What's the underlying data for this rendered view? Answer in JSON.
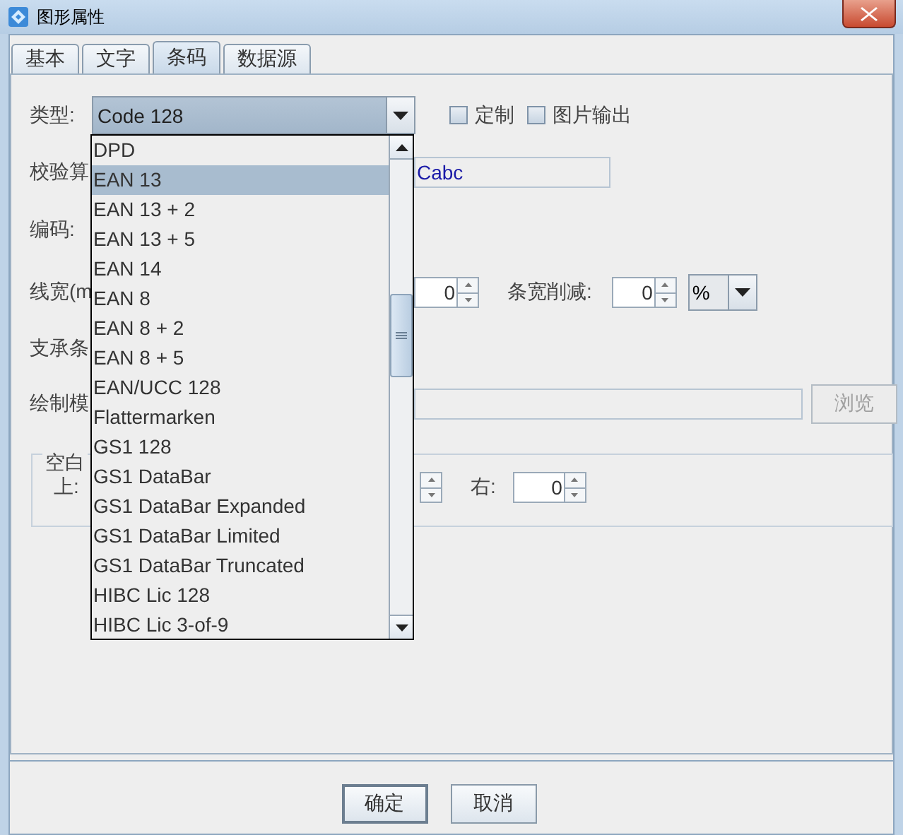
{
  "window": {
    "title": "图形属性"
  },
  "tabs": [
    {
      "label": "基本",
      "selected": false
    },
    {
      "label": "文字",
      "selected": false
    },
    {
      "label": "条码",
      "selected": true
    },
    {
      "label": "数据源",
      "selected": false
    }
  ],
  "type_field": {
    "label": "类型:",
    "value": "Code 128",
    "expanded": true
  },
  "options": [
    {
      "label": "定制",
      "checked": false
    },
    {
      "label": "图片输出",
      "checked": false
    }
  ],
  "dropdown": {
    "items": [
      {
        "label": "DPD",
        "selected": false
      },
      {
        "label": "EAN 13",
        "selected": true
      },
      {
        "label": "EAN 13 + 2",
        "selected": false
      },
      {
        "label": "EAN 13 + 5",
        "selected": false
      },
      {
        "label": "EAN 14",
        "selected": false
      },
      {
        "label": "EAN 8",
        "selected": false
      },
      {
        "label": "EAN 8 + 2",
        "selected": false
      },
      {
        "label": "EAN 8 + 5",
        "selected": false
      },
      {
        "label": "EAN/UCC 128",
        "selected": false
      },
      {
        "label": "Flattermarken",
        "selected": false
      },
      {
        "label": "GS1 128",
        "selected": false
      },
      {
        "label": "GS1 DataBar",
        "selected": false
      },
      {
        "label": "GS1 DataBar Expanded",
        "selected": false
      },
      {
        "label": "GS1 DataBar Limited",
        "selected": false
      },
      {
        "label": "GS1 DataBar Truncated",
        "selected": false
      },
      {
        "label": "HIBC Lic 128",
        "selected": false
      },
      {
        "label": "HIBC Lic 3-of-9",
        "selected": false
      }
    ]
  },
  "check_row": {
    "label": "校验算",
    "value": "Cabc"
  },
  "encoding_row": {
    "label": "编码:"
  },
  "line_width_row": {
    "label": "线宽(m",
    "value": "0",
    "reduction_label": "条宽削减:",
    "reduction_value": "0",
    "unit": "%"
  },
  "support_row": {
    "label": "支承条"
  },
  "template_row": {
    "label": "绘制模",
    "browse_button": {
      "label": "浏览",
      "disabled": true
    }
  },
  "margin_group": {
    "title": "空白",
    "top_label": "上:",
    "right_label": "右:",
    "right_value": "0"
  },
  "buttons": [
    {
      "label": "确定",
      "default": true
    },
    {
      "label": "取消",
      "default": false
    }
  ]
}
